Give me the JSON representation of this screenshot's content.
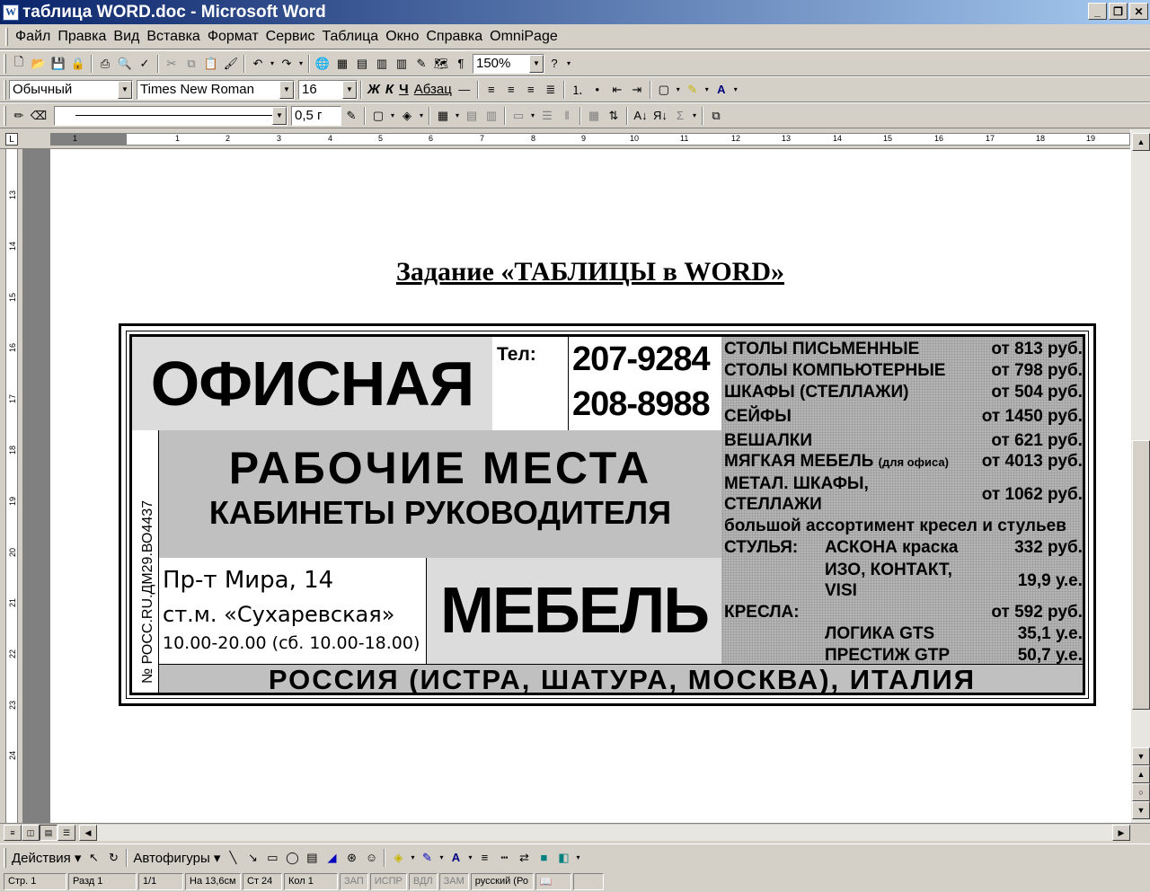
{
  "window": {
    "title": "таблица WORD.doc - Microsoft Word",
    "minimize": "_",
    "restore": "❐",
    "close": "✕",
    "app_icon": "W"
  },
  "menu": [
    "Файл",
    "Правка",
    "Вид",
    "Вставка",
    "Формат",
    "Сервис",
    "Таблица",
    "Окно",
    "Справка",
    "OmniPage"
  ],
  "toolbar_standard": {
    "zoom": "150%",
    "icons": [
      "new-document-icon",
      "open-icon",
      "save-icon",
      "permission-icon",
      "print-icon",
      "print-preview-icon",
      "spelling-icon",
      "cut-icon",
      "copy-icon",
      "paste-icon",
      "format-painter-icon",
      "undo-icon",
      "redo-icon",
      "hyperlink-icon",
      "tables-borders-icon",
      "insert-table-icon",
      "insert-excel-icon",
      "columns-icon",
      "drawing-icon",
      "document-map-icon",
      "show-hide-icon",
      "help-icon"
    ]
  },
  "toolbar_format": {
    "style": "Обычный",
    "font": "Times New Roman",
    "size": "16",
    "bold": "Ж",
    "italic": "К",
    "underline": "Ч",
    "paragraph": "Абзац"
  },
  "toolbar_tables": {
    "line_weight": "0,5 г"
  },
  "ruler": {
    "h_numbers": [
      "1",
      "1",
      "2",
      "3",
      "4",
      "5",
      "6",
      "7",
      "8",
      "9",
      "10",
      "11",
      "12",
      "13",
      "14",
      "15",
      "16",
      "17",
      "18",
      "19"
    ],
    "v_numbers": [
      "13",
      "14",
      "15",
      "16",
      "17",
      "18",
      "19",
      "20",
      "21",
      "22",
      "23",
      "24"
    ]
  },
  "document": {
    "heading": "Задание «ТАБЛИЦЫ в WORD»",
    "ad": {
      "ofis": "ОФИСНАЯ",
      "tel": "Тел:",
      "phone1": "207-9284",
      "phone2": "208-8988",
      "vertical": "№ РОСС.RU.ДМ29.ВО4437",
      "rabochie": "РАБОЧИЕ МЕСТА",
      "kabinety": "КАБИНЕТЫ РУКОВОДИТЕЛЯ",
      "addr1": "Пр-т Мира, 14",
      "addr2": "ст.м. «Сухаревская»",
      "addr3": "10.00-20.00 (сб. 10.00-18.00)",
      "mebel": "МЕБЕЛЬ",
      "russia": "РОССИЯ (ИСТРА, ШАТУРА, МОСКВА), ИТАЛИЯ",
      "prices": [
        {
          "item": "СТОЛЫ  ПИСЬМЕННЫЕ",
          "price": "от 813 руб."
        },
        {
          "item": "СТОЛЫ КОМПЬЮТЕРНЫЕ",
          "price": "от 798 руб."
        },
        {
          "item": "ШКАФЫ  (СТЕЛЛАЖИ)",
          "price": "от 504 руб."
        },
        {
          "item": "СЕЙФЫ",
          "price": "от 1450 руб."
        },
        {
          "item": "ВЕШАЛКИ",
          "price": "от 621 руб."
        }
      ],
      "soft_item": "МЯГКАЯ МЕБЕЛЬ",
      "soft_note": "(для офиса)",
      "soft_price": "от 4013 руб.",
      "metal_item1": "МЕТАЛ. ШКАФЫ,",
      "metal_item2": "СТЕЛЛАЖИ",
      "metal_price": "от 1062 руб.",
      "assort": "большой ассортимент кресел и стульев",
      "chairs_label": "СТУЛЬЯ:",
      "chairs1": "АСКОНА  краска",
      "chairs1_price": "332 руб.",
      "chairs2a": "ИЗО,  КОНТАКТ,",
      "chairs2b": "VISI",
      "chairs2_price": "19,9 у.е.",
      "armchairs_label": "КРЕСЛА:",
      "armchairs_price": "от 592 руб.",
      "arm1": "ЛОГИКА  GTS",
      "arm1_price": "35,1 у.е.",
      "arm2": "ПРЕСТИЖ  GTP",
      "arm2_price": "50,7 у.е."
    }
  },
  "drawing_toolbar": {
    "actions": "Действия ▾",
    "autoshapes": "Автофигуры ▾"
  },
  "status": {
    "page": "Стр.  1",
    "section": "Разд  1",
    "pages": "1/1",
    "at": "На 13,6см",
    "line": "Ст  24",
    "col": "Кол  1",
    "rec": "ЗАП",
    "trk": "ИСПР",
    "ext": "ВДЛ",
    "ovr": "ЗАМ",
    "lang": "русский (Ро"
  }
}
